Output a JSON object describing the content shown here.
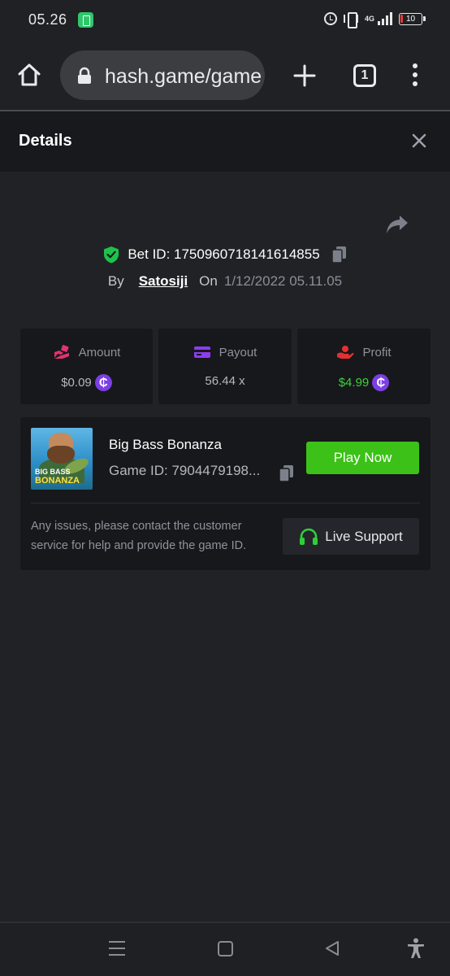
{
  "status_bar": {
    "time": "05.26",
    "network": "4G",
    "battery": "10"
  },
  "browser": {
    "url": "hash.game/game",
    "tab_count": "1"
  },
  "details": {
    "title": "Details",
    "bet_id_label": "Bet ID: 1750960718141614855",
    "by_label": "By",
    "username": "Satosiji",
    "on_label": "On",
    "date": "1/12/2022 05.11.05"
  },
  "stats": {
    "amount_label": "Amount",
    "amount_value": "$0.09",
    "payout_label": "Payout",
    "payout_value": "56.44 x",
    "profit_label": "Profit",
    "profit_value": "$4.99",
    "currency_symbol": "₵"
  },
  "game": {
    "name": "Big Bass Bonanza",
    "id_label": "Game ID: 7904479198...",
    "thumb_text_1": "BIG BASS",
    "thumb_text_2": "BONANZA",
    "play_label": "Play Now",
    "support_text": "Any issues, please contact the customer service for help and provide the game ID.",
    "support_label": "Live Support"
  },
  "icons": [
    "home-icon",
    "lock-icon",
    "plus-icon",
    "tabs-icon",
    "more-vert-icon",
    "close-icon",
    "share-icon",
    "shield-check-icon",
    "copy-icon",
    "amount-icon",
    "payout-card-icon",
    "profit-icon",
    "coin-icon",
    "headset-icon",
    "recents-icon",
    "home-nav-icon",
    "back-icon",
    "accessibility-icon"
  ],
  "colors": {
    "accent_green": "#3bc117",
    "profit_green": "#3cd13c",
    "coin_purple": "#7b3fe4",
    "amount_pink": "#e0346e",
    "payout_purple": "#8b3df0",
    "profit_red": "#e53030"
  }
}
